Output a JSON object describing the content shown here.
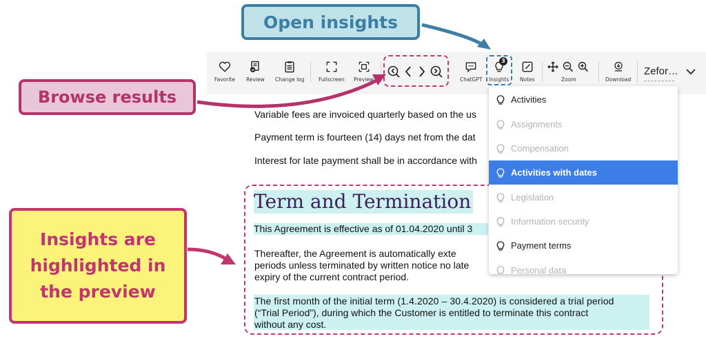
{
  "toolbar": {
    "favorite": "Favorite",
    "review": "Review",
    "change_log": "Change log",
    "fullscreen": "Fullscreen",
    "preview": "Preview",
    "chatgpt": "ChatGPT",
    "insights": "Insights",
    "insights_badge": "3",
    "notes": "Notes",
    "zoom": "Zoom",
    "download": "Download",
    "user_name": "Zefor…"
  },
  "document": {
    "line1": "Variable fees are invoiced quarterly based on the us",
    "line2": "Payment term is fourteen (14) days net from the dat",
    "line3": "Interest for late payment shall be in accordance with",
    "heading": "Term and Termination",
    "effective": "This Agreement is effective as of 01.04.2020 until 3",
    "thereafter_1": "Thereafter, the Agreement is automatically exte",
    "thereafter_2": "periods unless  terminated by written notice no late",
    "thereafter_3": "expiry of the current contract period.",
    "trial_1": "The first month of the initial term (1.4.2020 – 30.4.2020) is considered a trial period",
    "trial_2": "(“Trial Period”), during which the Customer is entitled to terminate this contract",
    "trial_3": "without any cost."
  },
  "insights_menu": {
    "items": [
      {
        "label": "Activities",
        "state": "active"
      },
      {
        "label": "Assignments",
        "state": "dim"
      },
      {
        "label": "Compensation",
        "state": "dim"
      },
      {
        "label": "Activities with dates",
        "state": "selected"
      },
      {
        "label": "Legislation",
        "state": "dim"
      },
      {
        "label": "Information security",
        "state": "dim"
      },
      {
        "label": "Payment terms",
        "state": "active"
      },
      {
        "label": "Personal data",
        "state": "dim"
      }
    ]
  },
  "callouts": {
    "open_insights": "Open insights",
    "browse_results": "Browse results",
    "insights_highlighted": "Insights are highlighted in the preview"
  },
  "colors": {
    "highlight": "#cdf0f1",
    "selected": "#3d7de6",
    "heading": "#3f1f58",
    "callout_blue": "#bfe3e8",
    "callout_pink": "#e9c7d9",
    "callout_yellow": "#fbf37a",
    "dashed_pink": "#c2366f",
    "dashed_blue": "#3c7ea6"
  }
}
